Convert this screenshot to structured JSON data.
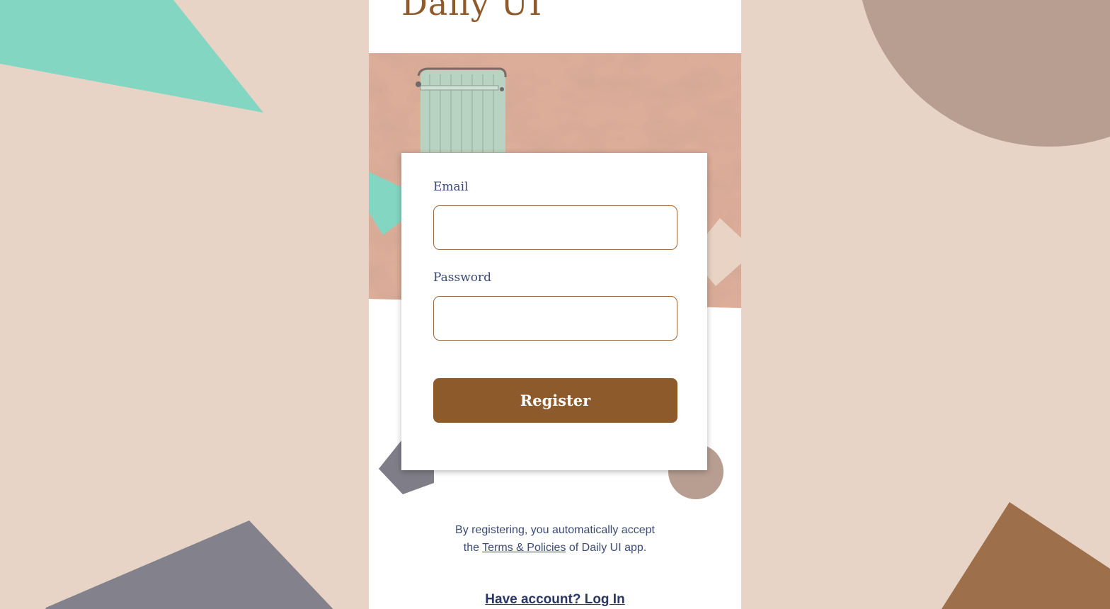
{
  "app": {
    "title": "Daily UI"
  },
  "form": {
    "email_label": "Email",
    "email_value": "",
    "email_placeholder": "",
    "password_label": "Password",
    "password_value": "",
    "password_placeholder": "",
    "submit_label": "Register"
  },
  "disclaimer": {
    "line1": "By registering, you automatically accept",
    "prefix": "the",
    "link": "Terms & Policies",
    "suffix": "of Daily UI app."
  },
  "login": {
    "label": "Have account? Log In"
  },
  "colors": {
    "background": "#e7d4c6",
    "accent_brown": "#8d5a2b",
    "teal": "#83d6c2",
    "slate": "#82818c",
    "mauve": "#b89e91",
    "text_navy": "#3c4a76"
  },
  "hero_image": {
    "subject": "green-wooden-shutter-on-terracotta-wall"
  }
}
